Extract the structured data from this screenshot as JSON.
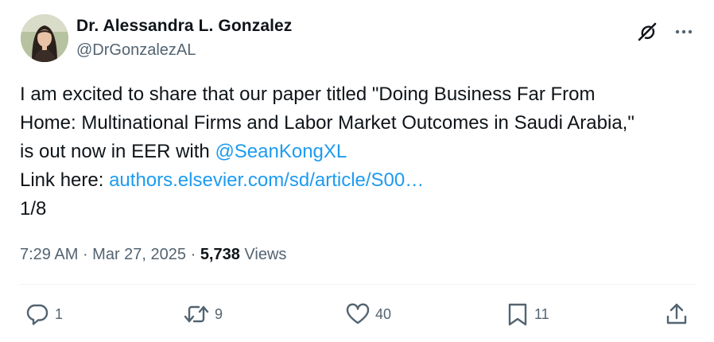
{
  "author": {
    "display_name": "Dr. Alessandra L. Gonzalez",
    "handle": "@DrGonzalezAL",
    "avatar_icon": "profile-photo"
  },
  "header_actions": {
    "grok_icon": "grok-icon",
    "more_icon": "more-horizontal-icon"
  },
  "tweet": {
    "line1": "I am excited to share that our paper titled \"Doing Business Far From",
    "line2": "Home: Multinational Firms and Labor Market Outcomes in Saudi Arabia,\"",
    "line3_prefix": "is out now in EER with ",
    "mention": "@SeanKongXL",
    "line4_prefix": "Link here: ",
    "link": "authors.elsevier.com/sd/article/S00…",
    "line5": "1/8"
  },
  "meta": {
    "time": "7:29 AM",
    "sep1": " · ",
    "date": "Mar 27, 2025",
    "sep2": " · ",
    "views_count": "5,738",
    "views_label": " Views"
  },
  "actions": {
    "reply": {
      "icon": "reply-icon",
      "count": "1"
    },
    "retweet": {
      "icon": "retweet-icon",
      "count": "9"
    },
    "like": {
      "icon": "heart-icon",
      "count": "40"
    },
    "bookmark": {
      "icon": "bookmark-icon",
      "count": "11"
    },
    "share": {
      "icon": "share-icon"
    }
  },
  "colors": {
    "text": "#0f1419",
    "secondary": "#536471",
    "link": "#1d9bf0",
    "divider": "#eff3f4"
  }
}
